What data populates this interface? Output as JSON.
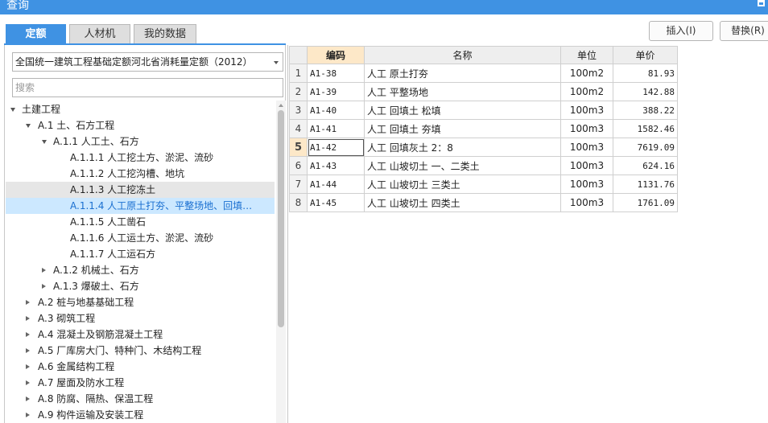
{
  "window": {
    "title": "查询"
  },
  "tabs": [
    {
      "label": "定额",
      "active": true
    },
    {
      "label": "人材机",
      "active": false
    },
    {
      "label": "我的数据",
      "active": false
    }
  ],
  "actions": {
    "insert": "插入(I)",
    "replace": "替换(R)"
  },
  "library": {
    "selected": "全国统一建筑工程基础定额河北省消耗量定额（2012）"
  },
  "search": {
    "placeholder": "搜索",
    "value": ""
  },
  "tree": [
    {
      "label": "土建工程",
      "toggle": "open",
      "level": 0
    },
    {
      "label": "A.1 土、石方工程",
      "toggle": "open",
      "level": 1
    },
    {
      "label": "A.1.1 人工土、石方",
      "toggle": "open",
      "level": 2
    },
    {
      "label": "A.1.1.1 人工挖土方、淤泥、流砂",
      "toggle": "none",
      "level": 3
    },
    {
      "label": "A.1.1.2 人工挖沟槽、地坑",
      "toggle": "none",
      "level": 3
    },
    {
      "label": "A.1.1.3 人工挖冻土",
      "toggle": "none",
      "level": 3,
      "state": "hover"
    },
    {
      "label": "A.1.1.4 人工原土打夯、平整场地、回填…",
      "toggle": "none",
      "level": 3,
      "state": "selected"
    },
    {
      "label": "A.1.1.5 人工凿石",
      "toggle": "none",
      "level": 3
    },
    {
      "label": "A.1.1.6 人工运土方、淤泥、流砂",
      "toggle": "none",
      "level": 3
    },
    {
      "label": "A.1.1.7 人工运石方",
      "toggle": "none",
      "level": 3
    },
    {
      "label": "A.1.2 机械土、石方",
      "toggle": "closed",
      "level": 2
    },
    {
      "label": "A.1.3 爆破土、石方",
      "toggle": "closed",
      "level": 2
    },
    {
      "label": "A.2 桩与地基基础工程",
      "toggle": "closed",
      "level": 1
    },
    {
      "label": "A.3 砌筑工程",
      "toggle": "closed",
      "level": 1
    },
    {
      "label": "A.4 混凝土及钢筋混凝土工程",
      "toggle": "closed",
      "level": 1
    },
    {
      "label": "A.5 厂库房大门、特种门、木结构工程",
      "toggle": "closed",
      "level": 1
    },
    {
      "label": "A.6 金属结构工程",
      "toggle": "closed",
      "level": 1
    },
    {
      "label": "A.7 屋面及防水工程",
      "toggle": "closed",
      "level": 1
    },
    {
      "label": "A.8 防腐、隔热、保温工程",
      "toggle": "closed",
      "level": 1
    },
    {
      "label": "A.9 构件运输及安装工程",
      "toggle": "closed",
      "level": 1
    }
  ],
  "table": {
    "columns": [
      "编码",
      "名称",
      "单位",
      "单价"
    ],
    "rows": [
      {
        "no": "1",
        "code": "A1-38",
        "name": "人工 原土打夯",
        "unit": "100m2",
        "price": "81.93"
      },
      {
        "no": "2",
        "code": "A1-39",
        "name": "人工 平整场地",
        "unit": "100m2",
        "price": "142.88"
      },
      {
        "no": "3",
        "code": "A1-40",
        "name": "人工 回填土 松填",
        "unit": "100m3",
        "price": "388.22"
      },
      {
        "no": "4",
        "code": "A1-41",
        "name": "人工 回填土 夯填",
        "unit": "100m3",
        "price": "1582.46"
      },
      {
        "no": "5",
        "code": "A1-42",
        "name": "人工 回填灰土 2：8",
        "unit": "100m3",
        "price": "7619.09",
        "current": true
      },
      {
        "no": "6",
        "code": "A1-43",
        "name": "人工 山坡切土 一、二类土",
        "unit": "100m3",
        "price": "624.16"
      },
      {
        "no": "7",
        "code": "A1-44",
        "name": "人工 山坡切土 三类土",
        "unit": "100m3",
        "price": "1131.76"
      },
      {
        "no": "8",
        "code": "A1-45",
        "name": "人工 山坡切土 四类土",
        "unit": "100m3",
        "price": "1761.09"
      }
    ]
  },
  "colors": {
    "accent": "#3f92e3",
    "selected_row": "#cce8ff",
    "header_highlight": "#fde8c8"
  }
}
